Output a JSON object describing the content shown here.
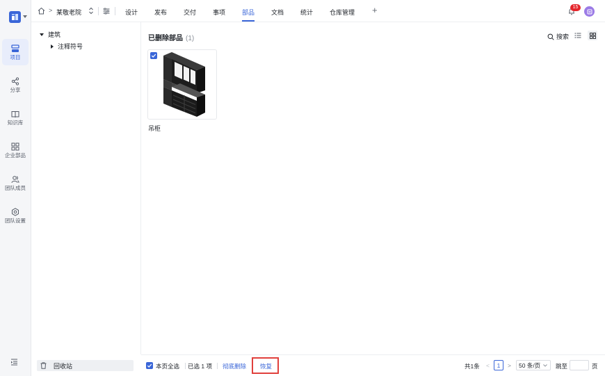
{
  "rail": {
    "items": [
      {
        "label": "项目",
        "icon": "project-icon",
        "active": true
      },
      {
        "label": "分享",
        "icon": "share-icon"
      },
      {
        "label": "知识库",
        "icon": "book-icon"
      },
      {
        "label": "企业部品",
        "icon": "components-grid-icon"
      },
      {
        "label": "团队成员",
        "icon": "team-members-icon"
      },
      {
        "label": "团队设置",
        "icon": "settings-icon"
      }
    ]
  },
  "header": {
    "breadcrumb_sep": ">",
    "project_name": "某敬老院",
    "tabs": [
      "设计",
      "发布",
      "交付",
      "事项",
      "部品",
      "文档",
      "统计",
      "仓库管理"
    ],
    "active_tab": "部品",
    "add_label": "+",
    "notification_count": "15"
  },
  "tree": {
    "root": "建筑",
    "child": "注释符号"
  },
  "main": {
    "title": "已删除部品",
    "count": "(1)",
    "search_label": "搜索",
    "items": [
      {
        "name": "吊柜",
        "checked": true
      }
    ]
  },
  "recycle_bin": {
    "label": "回收站"
  },
  "footer": {
    "select_all": "本页全选",
    "selected_text": "已选 1 项",
    "delete_label": "彻底删除",
    "restore_label": "恢复",
    "total": "共1条",
    "prev": "<",
    "page": "1",
    "next": ">",
    "page_size": "50 条/页",
    "jump_label": "跳至",
    "page_unit": "页"
  },
  "colors": {
    "accent": "#3a66d8",
    "badge": "#e5262c",
    "highlight_border": "#e0403c",
    "avatar": "#9b7be6"
  }
}
